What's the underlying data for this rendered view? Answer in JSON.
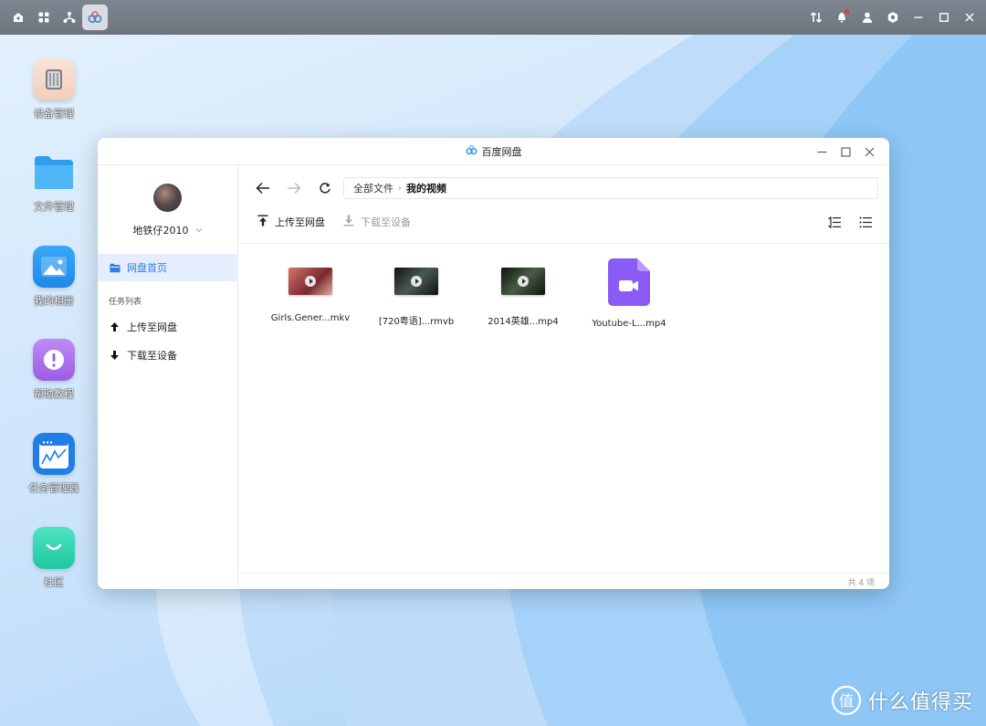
{
  "taskbar": {
    "left_icons": [
      "home-icon",
      "apps-grid-icon",
      "network-tree-icon",
      "baidu-netdisk-icon"
    ],
    "right_icons": [
      "transfer-icon",
      "bell-icon",
      "user-icon",
      "settings-icon",
      "minimize-icon",
      "maximize-icon",
      "close-icon"
    ],
    "notification_dot_color": "#e53935"
  },
  "desktop": {
    "icons": [
      {
        "label": "设备管理",
        "icon": "device-manager-icon"
      },
      {
        "label": "文件管理",
        "icon": "folder-icon"
      },
      {
        "label": "我的相册",
        "icon": "photo-album-icon"
      },
      {
        "label": "帮助教程",
        "icon": "help-icon"
      },
      {
        "label": "任务管理器",
        "icon": "task-manager-icon"
      },
      {
        "label": "社区",
        "icon": "community-icon"
      }
    ]
  },
  "window": {
    "title": "百度网盘",
    "sidebar": {
      "username": "地铁仔2010",
      "active_item": "网盘首页",
      "section_title": "任务列表",
      "items": [
        {
          "label": "上传至网盘",
          "icon": "upload-arrow-icon"
        },
        {
          "label": "下载至设备",
          "icon": "download-arrow-icon"
        }
      ]
    },
    "breadcrumb": {
      "root": "全部文件",
      "separator": "›",
      "current": "我的视频"
    },
    "toolbar": {
      "upload_label": "上传至网盘",
      "download_label": "下载至设备"
    },
    "files": [
      {
        "name": "Girls.Gener...mkv",
        "type": "video-thumb",
        "thumb_color": "#8b2e2e"
      },
      {
        "name": "[720粤语]...rmvb",
        "type": "video-thumb",
        "thumb_color": "#2b3a3a"
      },
      {
        "name": "2014英雄...mp4",
        "type": "video-thumb",
        "thumb_color": "#2e3d2a"
      },
      {
        "name": "Youtube-L...mp4",
        "type": "video-file",
        "thumb_color": "#8a5cf5"
      }
    ],
    "status": {
      "count": "共 4 项"
    }
  },
  "watermark": {
    "text": "什么值得买",
    "badge": "值"
  },
  "colors": {
    "accent": "#2f7ee6",
    "active_nav_bg": "#e4eefc",
    "taskbar": "#737b84"
  }
}
